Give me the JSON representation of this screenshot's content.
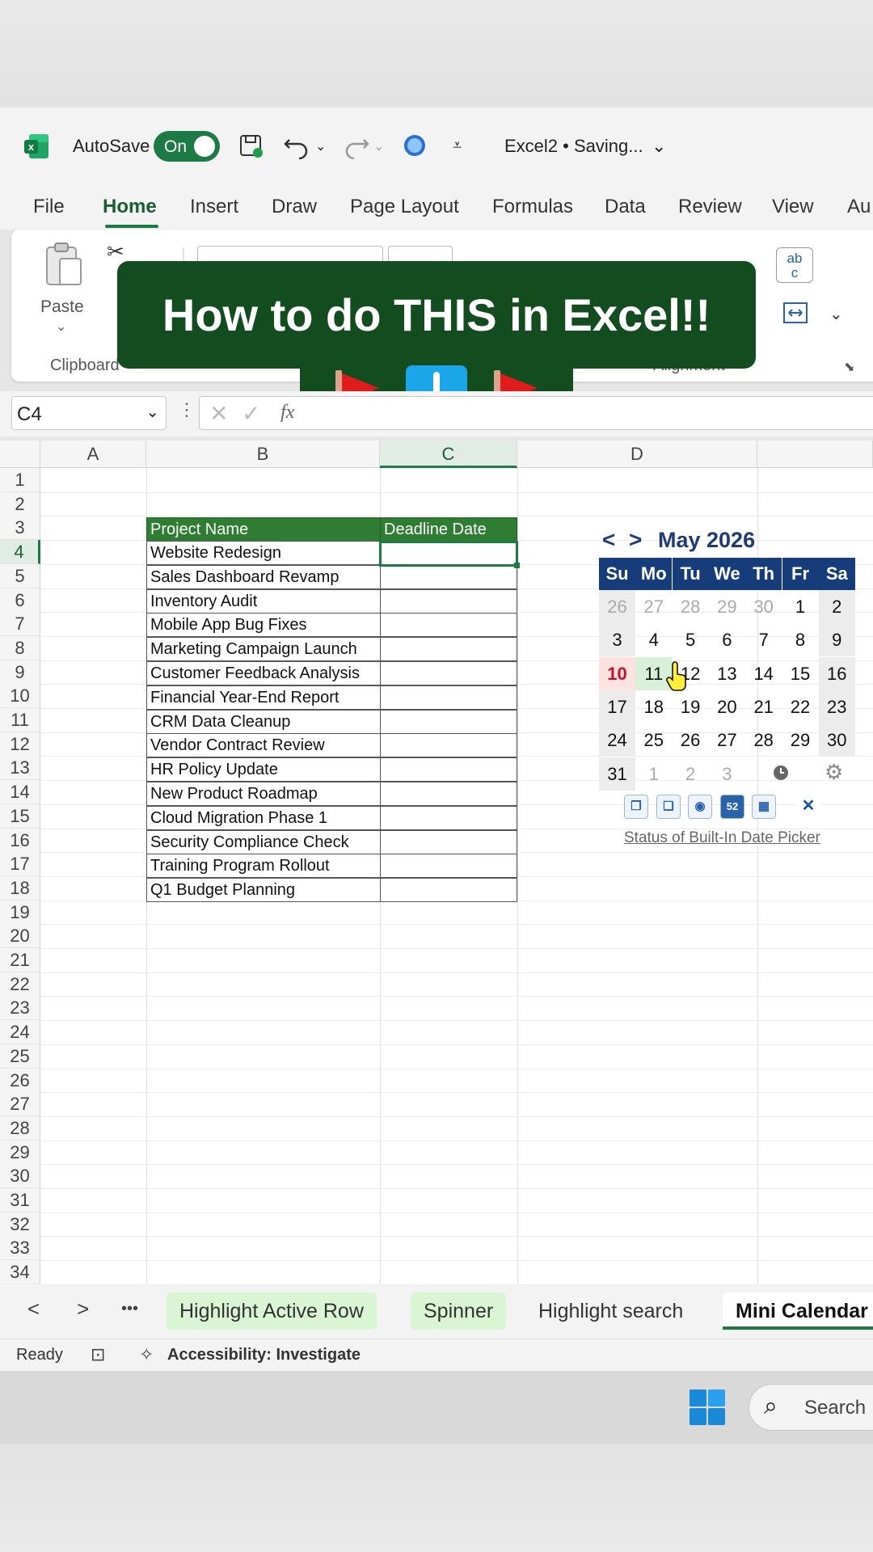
{
  "titlebar": {
    "autosave_label": "AutoSave",
    "autosave_state": "On",
    "file_title": "Excel2 • Saving..."
  },
  "menu": {
    "items": [
      "File",
      "Home",
      "Insert",
      "Draw",
      "Page Layout",
      "Formulas",
      "Data",
      "Review",
      "View",
      "Au"
    ],
    "active": "Home"
  },
  "ribbon": {
    "paste_label": "Paste",
    "clipboard_label": "Clipboard",
    "alignment_label": "Alignment"
  },
  "banner": {
    "text": "How to do THIS in Excel!!"
  },
  "formula_bar": {
    "name_box": "C4",
    "fx": "fx"
  },
  "grid": {
    "columns": [
      "A",
      "B",
      "C",
      "D"
    ],
    "rows": [
      "1",
      "2",
      "3",
      "4",
      "5",
      "6",
      "7",
      "8",
      "9",
      "10",
      "11",
      "12",
      "13",
      "14",
      "15",
      "16",
      "17",
      "18",
      "19",
      "20",
      "21",
      "22",
      "23",
      "24",
      "25",
      "26",
      "27",
      "28",
      "29",
      "30",
      "31",
      "32",
      "33",
      "34"
    ],
    "selected_column": "C",
    "selected_row": "4"
  },
  "table": {
    "headers": [
      "Project Name",
      "Deadline Date"
    ],
    "projects": [
      "Website Redesign",
      "Sales Dashboard Revamp",
      "Inventory Audit",
      "Mobile App Bug Fixes",
      "Marketing Campaign Launch",
      "Customer Feedback Analysis",
      "Financial Year-End Report",
      "CRM Data Cleanup",
      "Vendor Contract Review",
      "HR Policy Update",
      "New Product Roadmap",
      "Cloud Migration Phase 1",
      "Security Compliance Check",
      "Training Program Rollout",
      "Q1 Budget Planning"
    ]
  },
  "calendar": {
    "prev": "<",
    "next": ">",
    "title": "May 2026",
    "weekdays": [
      "Su",
      "Mo",
      "Tu",
      "We",
      "Th",
      "Fr",
      "Sa"
    ],
    "weeks": [
      [
        "26",
        "27",
        "28",
        "29",
        "30",
        "1",
        "2"
      ],
      [
        "3",
        "4",
        "5",
        "6",
        "7",
        "8",
        "9"
      ],
      [
        "10",
        "11",
        "12",
        "13",
        "14",
        "15",
        "16"
      ],
      [
        "17",
        "18",
        "19",
        "20",
        "21",
        "22",
        "23"
      ],
      [
        "24",
        "25",
        "26",
        "27",
        "28",
        "29",
        "30"
      ],
      [
        "31",
        "1",
        "2",
        "3",
        "",
        "",
        " "
      ]
    ],
    "today": "10",
    "status_link": "Status of Built-In Date Picker",
    "toolbar_icons": [
      "restore-window-icon",
      "restore-window-alt-icon",
      "globe-icon",
      "week-number-icon",
      "calendar-grid-icon",
      "close-icon"
    ],
    "week_badge": "52"
  },
  "sheets": {
    "tabs": [
      "Highlight Active Row",
      "Spinner",
      "Highlight search",
      "Mini Calendar"
    ],
    "active": "Mini Calendar",
    "more": "•••"
  },
  "status": {
    "ready": "Ready",
    "accessibility": "Accessibility: Investigate"
  },
  "taskbar": {
    "search_label": "Search"
  },
  "colors": {
    "excel_green": "#1e7a45",
    "table_header": "#2e7d32",
    "banner_bg": "#134d1f",
    "calendar_header": "#163c7a",
    "today": "#c8102e"
  }
}
